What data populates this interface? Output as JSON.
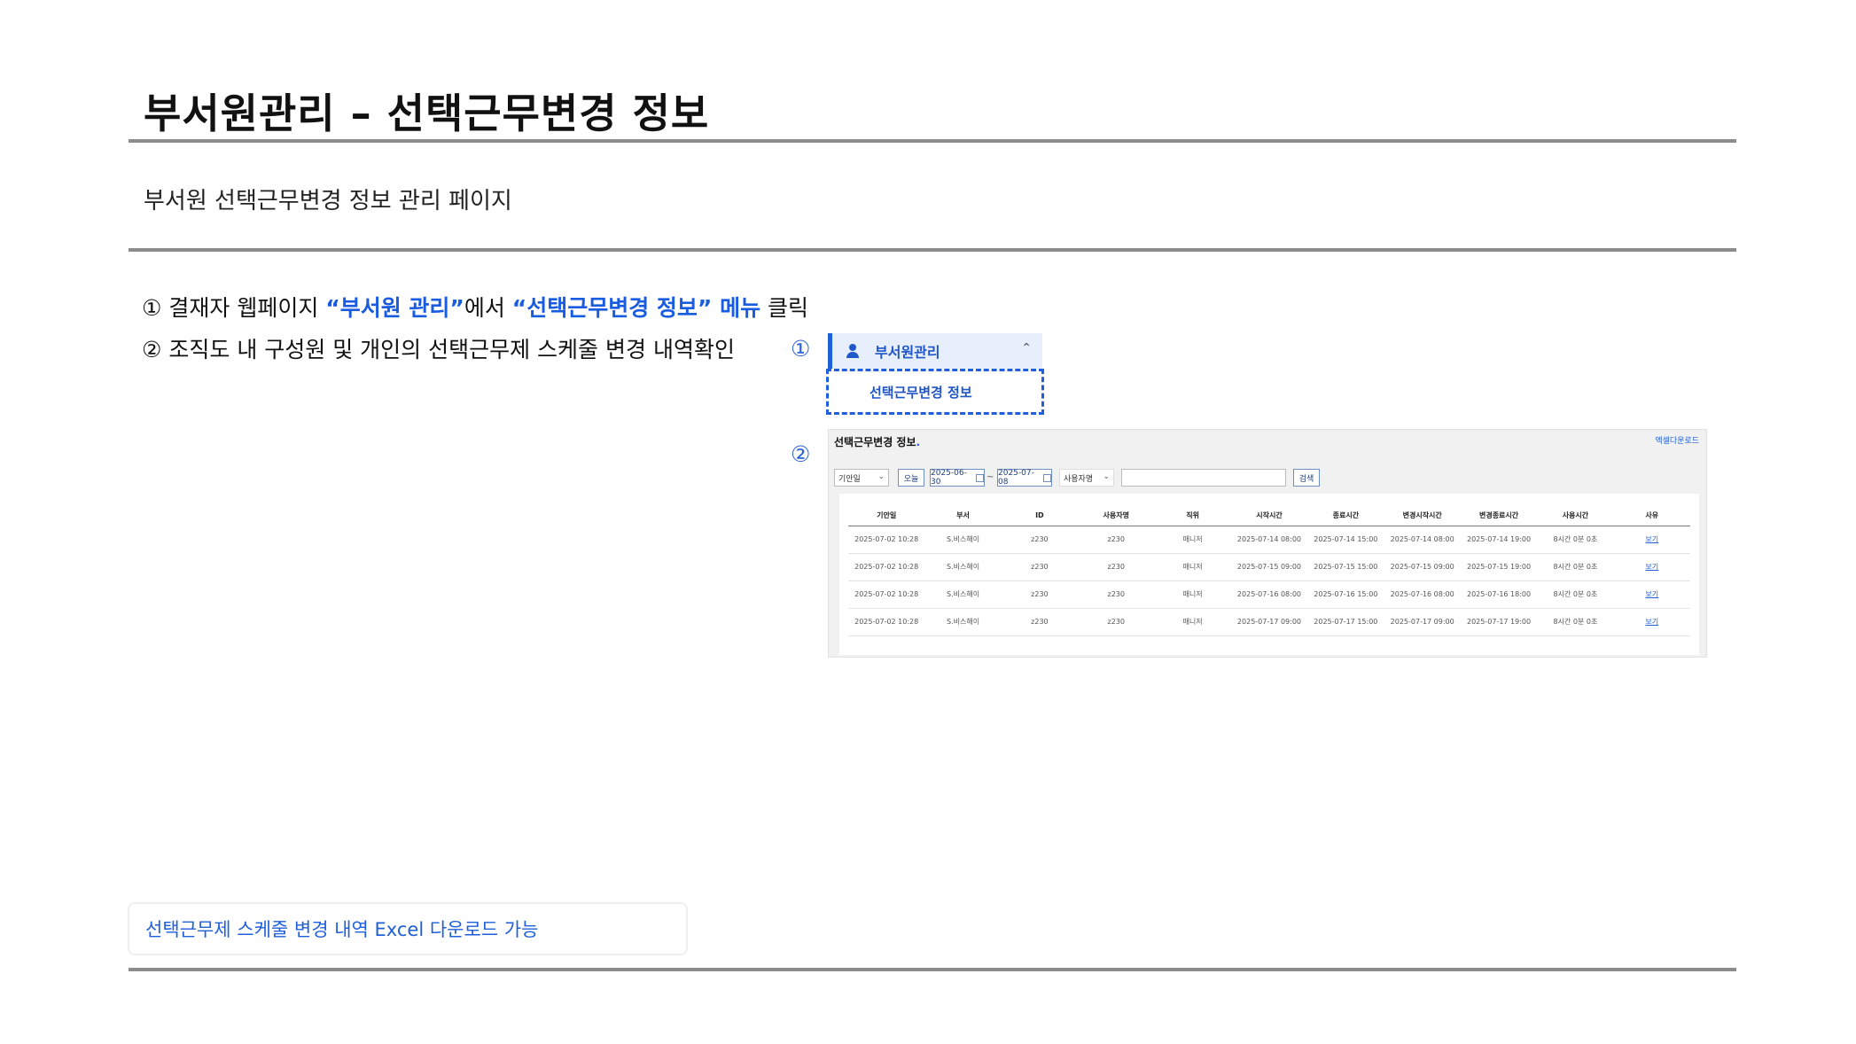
{
  "header": {
    "title": "부서원관리 – 선택근무변경 정보",
    "subtitle": "부서원 선택근무변경 정보 관리 페이지"
  },
  "steps": [
    {
      "num": "①",
      "pre": " 결재자 웹페이지 ",
      "hl1": "“부서원 관리”",
      "mid": "에서 ",
      "hl2": "“선택근무변경 정보” 메뉴",
      "post": " 클릭"
    },
    {
      "num": "②",
      "text": " 조직도 내 구성원 및 개인의 선택근무제 스케줄 변경 내역확인"
    }
  ],
  "markers": {
    "m1": "①",
    "m2": "②"
  },
  "menu": {
    "parent_label": "부서원관리",
    "child_label": "선택근무변경 정보",
    "icons": [
      "user-icon",
      "chevron-up-icon"
    ]
  },
  "screenshot": {
    "page_title": "선택근무변경 정보",
    "excel_button": "엑셀다운로드",
    "filters": {
      "period_select": "기안일",
      "today_button": "오늘",
      "date_from": "2025-06-30",
      "separator": "~",
      "date_to": "2025-07-08",
      "name_select": "사용자명",
      "search_value": "",
      "search_button": "검색"
    },
    "columns": [
      "기안일",
      "부서",
      "ID",
      "사용자명",
      "직위",
      "시작시간",
      "종료시간",
      "변경시작시간",
      "변경종료시간",
      "사용시간",
      "사유"
    ],
    "rows": [
      [
        "2025-07-02 10:28",
        "S.비스해이",
        "z230",
        "z230",
        "매니저",
        "2025-07-14 08:00",
        "2025-07-14 15:00",
        "2025-07-14 08:00",
        "2025-07-14 19:00",
        "8시간 0분 0초",
        "보기"
      ],
      [
        "2025-07-02 10:28",
        "S.비스해이",
        "z230",
        "z230",
        "매니저",
        "2025-07-15 09:00",
        "2025-07-15 15:00",
        "2025-07-15 09:00",
        "2025-07-15 19:00",
        "8시간 0분 0초",
        "보기"
      ],
      [
        "2025-07-02 10:28",
        "S.비스해이",
        "z230",
        "z230",
        "매니저",
        "2025-07-16 08:00",
        "2025-07-16 15:00",
        "2025-07-16 08:00",
        "2025-07-16 18:00",
        "8시간 0분 0초",
        "보기"
      ],
      [
        "2025-07-02 10:28",
        "S.비스해이",
        "z230",
        "z230",
        "매니저",
        "2025-07-17 09:00",
        "2025-07-17 15:00",
        "2025-07-17 09:00",
        "2025-07-17 19:00",
        "8시간 0분 0초",
        "보기"
      ]
    ]
  },
  "note": "선택근무제 스케줄 변경 내역 Excel 다운로드 가능",
  "colors": {
    "accent": "#1f5fd9",
    "rule": "#8c8c8c",
    "menu_bg": "#e7eefc"
  }
}
